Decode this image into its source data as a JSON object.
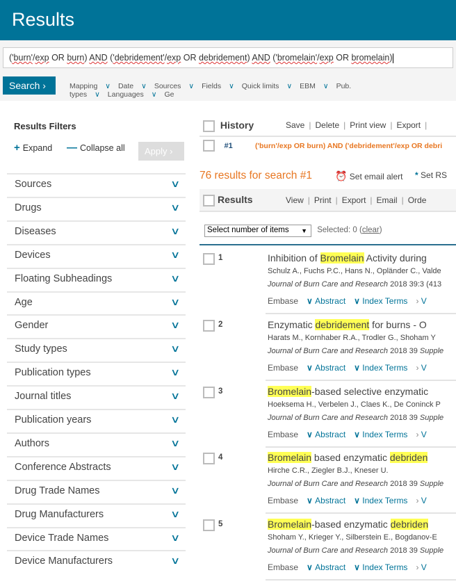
{
  "header": {
    "title": "Results"
  },
  "search": {
    "query_parts": [
      [
        "(",
        ""
      ],
      [
        "'burn'",
        "sq"
      ],
      [
        "/",
        ""
      ],
      [
        "exp",
        "sq"
      ],
      [
        " OR ",
        ""
      ],
      [
        "burn",
        "sq"
      ],
      [
        ") ",
        ""
      ],
      [
        "AND",
        "sq"
      ],
      [
        " (",
        ""
      ],
      [
        "'debridement'",
        "sq"
      ],
      [
        "/",
        ""
      ],
      [
        "exp",
        "sq"
      ],
      [
        " OR ",
        ""
      ],
      [
        "debridement",
        "sq"
      ],
      [
        ") ",
        ""
      ],
      [
        "AND",
        "sq"
      ],
      [
        " (",
        ""
      ],
      [
        "'bromelain'",
        "sq"
      ],
      [
        "/",
        ""
      ],
      [
        "exp",
        "sq"
      ],
      [
        " OR ",
        ""
      ],
      [
        "bromelain",
        "sq"
      ],
      [
        ")",
        ""
      ]
    ],
    "button": "Search",
    "filters": [
      "Mapping",
      "Date",
      "Sources",
      "Fields",
      "Quick limits",
      "EBM",
      "Pub. types",
      "Languages",
      "Ge"
    ]
  },
  "sidebar": {
    "title": "Results Filters",
    "expand": "Expand",
    "collapse": "Collapse all",
    "apply": "Apply",
    "items": [
      "Sources",
      "Drugs",
      "Diseases",
      "Devices",
      "Floating Subheadings",
      "Age",
      "Gender",
      "Study types",
      "Publication types",
      "Journal titles",
      "Publication years",
      "Authors",
      "Conference Abstracts",
      "Drug Trade Names",
      "Drug Manufacturers",
      "Device Trade Names",
      "Device Manufacturers"
    ]
  },
  "history": {
    "title": "History",
    "actions": [
      "Save",
      "Delete",
      "Print view",
      "Export"
    ],
    "entry_num": "#1",
    "entry_query": "('burn'/exp OR burn) AND ('debridement'/exp OR debri"
  },
  "count": {
    "text": "76 results for search #1",
    "email_alert": "Set email alert",
    "rss": "Set RS"
  },
  "results_bar": {
    "title": "Results",
    "actions": [
      "View",
      "Print",
      "Export",
      "Email",
      "Orde"
    ]
  },
  "select": {
    "value": "Select number of items",
    "selected_label": "Selected:",
    "selected_count": "0",
    "clear": "clear"
  },
  "results": [
    {
      "num": "1",
      "title": [
        [
          "Inhibition of ",
          ""
        ],
        [
          "Bromelain",
          "hl"
        ],
        [
          " Activity during",
          ""
        ]
      ],
      "authors": "Schulz A., Fuchs P.C., Hans N., Opländer C., Valde",
      "journal": "Journal of Burn Care and Research",
      "detail": " 2018 39:3 (413",
      "detail_it": ""
    },
    {
      "num": "2",
      "title": [
        [
          "Enzymatic ",
          ""
        ],
        [
          "debridement",
          "hl"
        ],
        [
          " for burns - O",
          ""
        ]
      ],
      "authors": "Harats M., Kornhaber R.A., Trodler G., Shoham Y",
      "journal": "Journal of Burn Care and Research",
      "detail": " 2018 39 ",
      "detail_it": "Supple"
    },
    {
      "num": "3",
      "title": [
        [
          "Bromelain",
          "hl"
        ],
        [
          "-based selective enzymatic",
          ""
        ]
      ],
      "authors": "Hoeksema H., Verbelen J., Claes K., De Coninck P",
      "journal": "Journal of Burn Care and Research",
      "detail": " 2018 39 ",
      "detail_it": "Supple"
    },
    {
      "num": "4",
      "title": [
        [
          "Bromelain",
          "hl"
        ],
        [
          " based enzymatic ",
          ""
        ],
        [
          "debriden",
          "hl"
        ]
      ],
      "authors": "Hirche C.R., Ziegler B.J., Kneser U.",
      "journal": "Journal of Burn Care and Research",
      "detail": " 2018 39 ",
      "detail_it": "Supple"
    },
    {
      "num": "5",
      "title": [
        [
          "Bromelain",
          "hl"
        ],
        [
          "-based enzymatic ",
          ""
        ],
        [
          "debriden",
          "hl"
        ]
      ],
      "authors": "Shoham Y., Krieger Y., Silberstein E., Bogdanov-E",
      "journal": "Journal of Burn Care and Research",
      "detail": " 2018 39 ",
      "detail_it": "Supple"
    }
  ],
  "result_links": {
    "source": "Embase",
    "abstract": "Abstract",
    "index": "Index Terms",
    "more": "V"
  },
  "colors": {
    "brand": "#007398",
    "highlight": "#ffff55",
    "count": "#e87722"
  }
}
